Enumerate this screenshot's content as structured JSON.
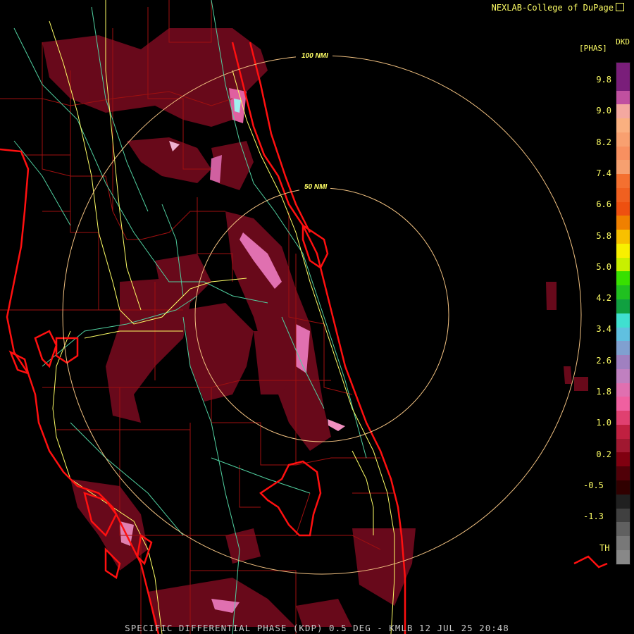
{
  "header": {
    "credit": "NEXLAB-College of DuPage",
    "product_code": "DKD",
    "unit": "[PHAS]"
  },
  "range_rings": [
    {
      "label": "100 NMI",
      "nmi": 100
    },
    {
      "label": "50 NMI",
      "nmi": 50
    }
  ],
  "legend": {
    "ticks": [
      "9.8",
      "9.0",
      "8.2",
      "7.4",
      "6.6",
      "5.8",
      "5.0",
      "4.2",
      "3.4",
      "2.6",
      "1.8",
      "1.0",
      "0.2",
      "-0.5",
      "-1.3"
    ],
    "th_label": "TH",
    "colors": [
      "#7a1e7a",
      "#7a1e7a",
      "#c050a0",
      "#f4a8a0",
      "#fab080",
      "#f8a070",
      "#f89060",
      "#f6a070",
      "#f47030",
      "#f06020",
      "#ee5010",
      "#f08000",
      "#f8c000",
      "#f8f000",
      "#c8f000",
      "#38e000",
      "#20c020",
      "#10a040",
      "#40e0d0",
      "#60c0e0",
      "#80a0d0",
      "#a080c0",
      "#c080c0",
      "#e070b0",
      "#f060a0",
      "#e04070",
      "#c02040",
      "#a01830",
      "#800010",
      "#500008",
      "#300000",
      "#202020",
      "#404040",
      "#606060",
      "#787878",
      "#888888"
    ]
  },
  "footer": {
    "caption": "SPECIFIC DIFFERENTIAL PHASE (KDP) 0.5 DEG - KMLB 12 JUL 25 20:48"
  },
  "radar": {
    "site": "KMLB",
    "product": "Specific Differential Phase (KDP)",
    "elevation_deg": 0.5,
    "date": "12 JUL 25",
    "time": "20:48"
  },
  "colors": {
    "background": "#000000",
    "coast": "#ff1010",
    "county_lines": "#a01010",
    "highways": "#ffff66",
    "roads": "#60e0a0",
    "range_ring": "#f0c080",
    "echo": "#7a0a1e"
  }
}
